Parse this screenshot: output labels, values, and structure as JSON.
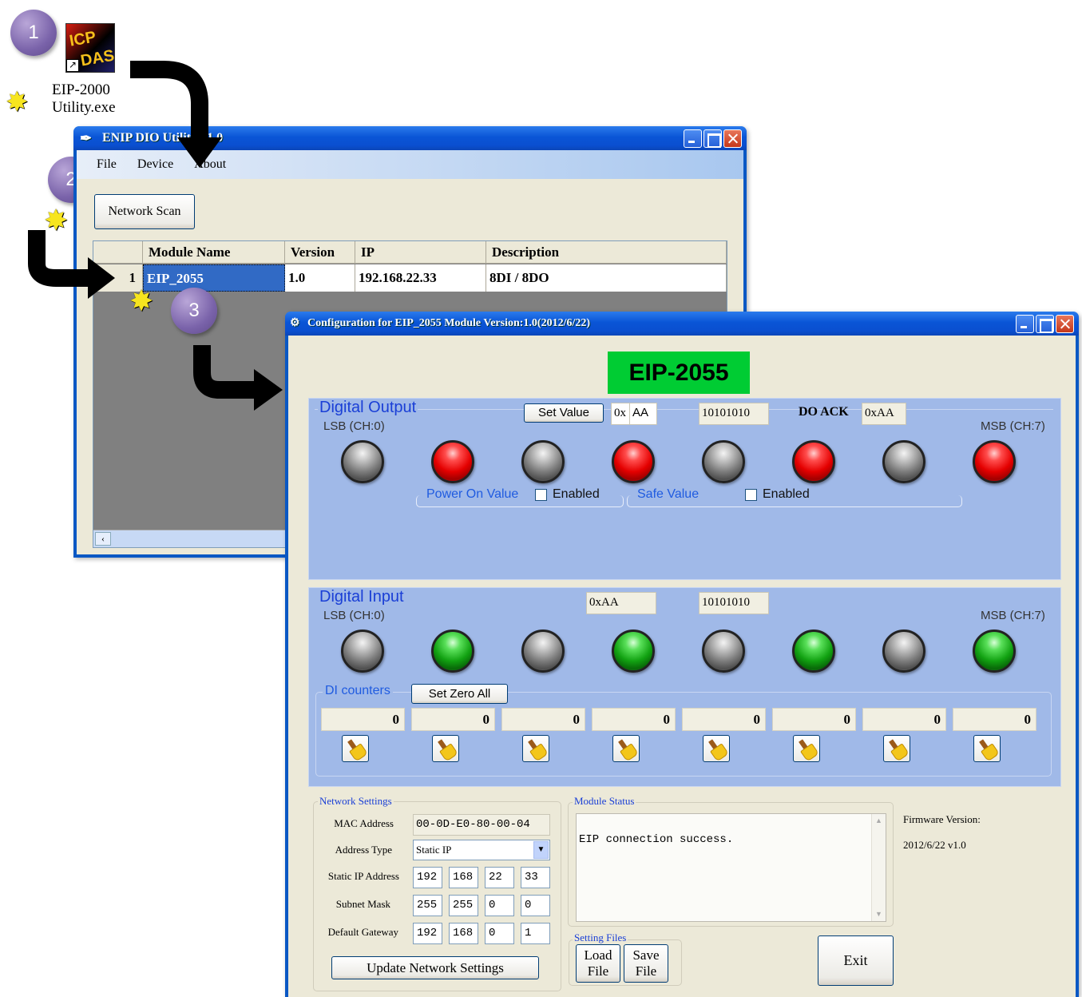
{
  "steps": [
    "1",
    "2",
    "3"
  ],
  "desktop_icon": {
    "label_line1": "EIP-2000",
    "label_line2": "Utility.exe"
  },
  "main_window": {
    "title": "ENIP DIO Utility v1.0",
    "menu": [
      "File",
      "Device",
      "About"
    ],
    "scan_button": "Network Scan",
    "columns": [
      "Module Name",
      "Version",
      "IP",
      "Description"
    ],
    "rows": [
      {
        "index": "1",
        "module": "EIP_2055",
        "version": "1.0",
        "ip": "192.168.22.33",
        "description": "8DI / 8DO"
      }
    ]
  },
  "config_window": {
    "title": "Configuration for EIP_2055 Module Version:1.0(2012/6/22)",
    "model_badge": "EIP-2055",
    "digital_output": {
      "title": "Digital Output",
      "set_value_button": "Set Value",
      "hex_prefix": "0x",
      "hex_value": "AA",
      "binary": "10101010",
      "ack_label": "DO ACK",
      "ack_value": "0xAA",
      "lsb": "LSB (CH:0)",
      "msb": "MSB (CH:7)",
      "leds": [
        "off",
        "red",
        "off",
        "red",
        "off",
        "red",
        "off",
        "red"
      ],
      "power_on_label": "Power On Value",
      "power_on_enabled": "Enabled",
      "safe_label": "Safe Value",
      "safe_enabled": "Enabled"
    },
    "digital_input": {
      "title": "Digital Input",
      "hex": "0xAA",
      "binary": "10101010",
      "lsb": "LSB (CH:0)",
      "msb": "MSB (CH:7)",
      "leds": [
        "off",
        "green",
        "off",
        "green",
        "off",
        "green",
        "off",
        "green"
      ],
      "counters_label": "DI counters",
      "zero_button": "Set Zero All",
      "counters": [
        "0",
        "0",
        "0",
        "0",
        "0",
        "0",
        "0",
        "0"
      ]
    },
    "network": {
      "title": "Network Settings",
      "mac_label": "MAC Address",
      "mac": "00-0D-E0-80-00-04",
      "addr_type_label": "Address Type",
      "addr_type": "Static IP",
      "ip_label": "Static IP Address",
      "ip": [
        "192",
        "168",
        "22",
        "33"
      ],
      "mask_label": "Subnet Mask",
      "mask": [
        "255",
        "255",
        "0",
        "0"
      ],
      "gw_label": "Default Gateway",
      "gw": [
        "192",
        "168",
        "0",
        "1"
      ],
      "update_button": "Update Network Settings"
    },
    "status": {
      "title": "Module Status",
      "message": "EIP connection success."
    },
    "firmware": {
      "label": "Firmware Version:",
      "value": "2012/6/22 v1.0"
    },
    "files": {
      "title": "Setting Files",
      "load_l1": "Load",
      "load_l2": "File",
      "save_l1": "Save",
      "save_l2": "File"
    },
    "exit_button": "Exit"
  }
}
